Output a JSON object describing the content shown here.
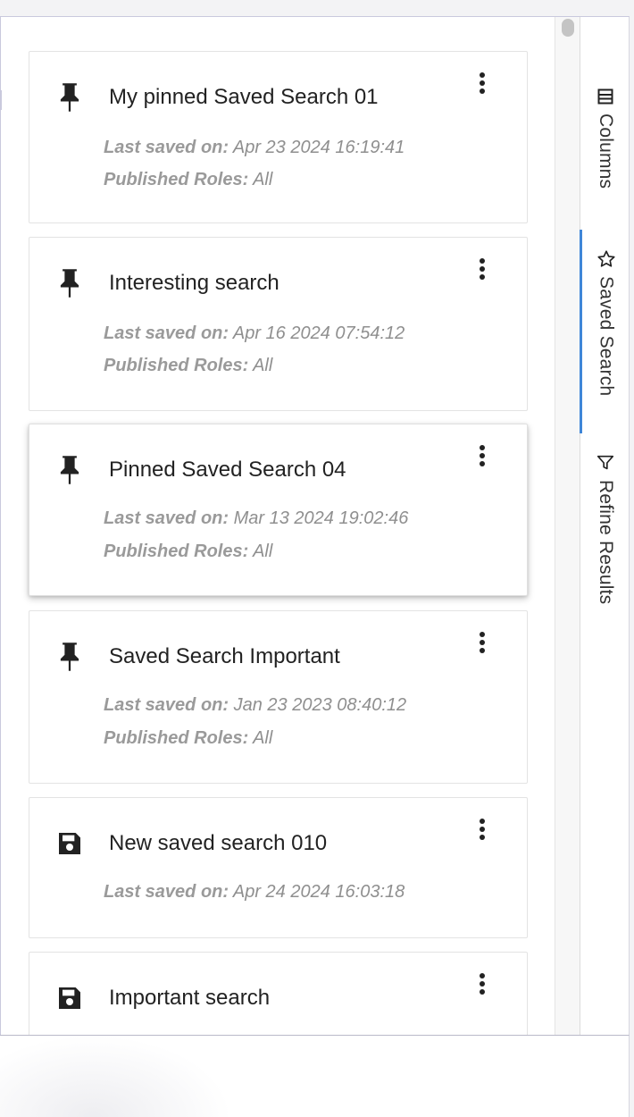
{
  "side_tabs": [
    {
      "label": "Columns",
      "icon": "columns-icon",
      "active": false
    },
    {
      "label": "Saved Search",
      "icon": "star-icon",
      "active": true
    },
    {
      "label": "Refine Results",
      "icon": "filter-icon",
      "active": false
    }
  ],
  "accent_color": "#3f86d8",
  "saved_searches": [
    {
      "icon": "pin-icon",
      "title": "My pinned Saved Search 01",
      "last_saved_label": "Last saved on:",
      "last_saved": "Apr 23 2024 16:19:41",
      "roles_label": "Published Roles:",
      "roles": "All"
    },
    {
      "icon": "pin-icon",
      "title": "Interesting search",
      "last_saved_label": "Last saved on:",
      "last_saved": "Apr 16 2024 07:54:12",
      "roles_label": "Published Roles:",
      "roles": "All"
    },
    {
      "icon": "pin-icon",
      "title": "Pinned Saved Search 04",
      "last_saved_label": "Last saved on:",
      "last_saved": "Mar 13 2024 19:02:46",
      "roles_label": "Published Roles:",
      "roles": "All"
    },
    {
      "icon": "pin-icon",
      "title": "Saved Search Important",
      "last_saved_label": "Last saved on:",
      "last_saved": "Jan 23 2023 08:40:12",
      "roles_label": "Published Roles:",
      "roles": "All"
    },
    {
      "icon": "save-icon",
      "title": "New saved search 010",
      "last_saved_label": "Last saved on:",
      "last_saved": "Apr 24 2024 16:03:18"
    },
    {
      "icon": "save-icon",
      "title": "Important search"
    }
  ]
}
